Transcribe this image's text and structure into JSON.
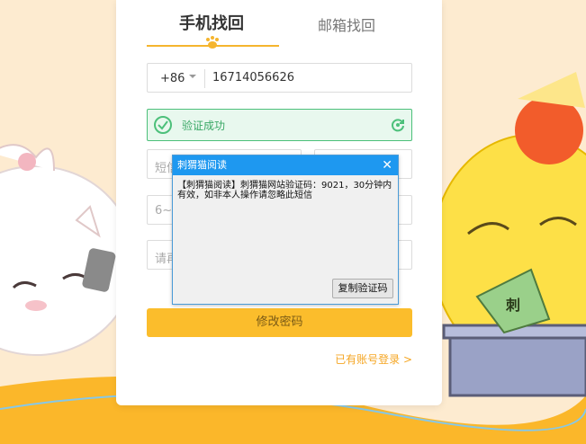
{
  "tabs": {
    "phone": "手机找回",
    "email": "邮箱找回"
  },
  "phone": {
    "country_code": "+86",
    "number": "16714056626"
  },
  "captcha": {
    "status": "验证成功"
  },
  "sms": {
    "placeholder_partial": "短信"
  },
  "password": {
    "placeholder_partial": "6~1"
  },
  "confirm_password": {
    "placeholder_partial": "请再"
  },
  "submit": {
    "label": "修改密码"
  },
  "login_link": {
    "label": "已有账号登录 >"
  },
  "dialog": {
    "title": "刺猬猫阅读",
    "close": "✕",
    "message": "【刺猬猫阅读】刺猬猫网站验证码：9021，30分钟内有效，如非本人操作请忽略此短信",
    "copy_button": "复制验证码"
  },
  "mascot_fan_text": "刺",
  "colors": {
    "accent": "#fbbd2c",
    "success": "#4cc07a",
    "dialog_title": "#1e98f0"
  }
}
